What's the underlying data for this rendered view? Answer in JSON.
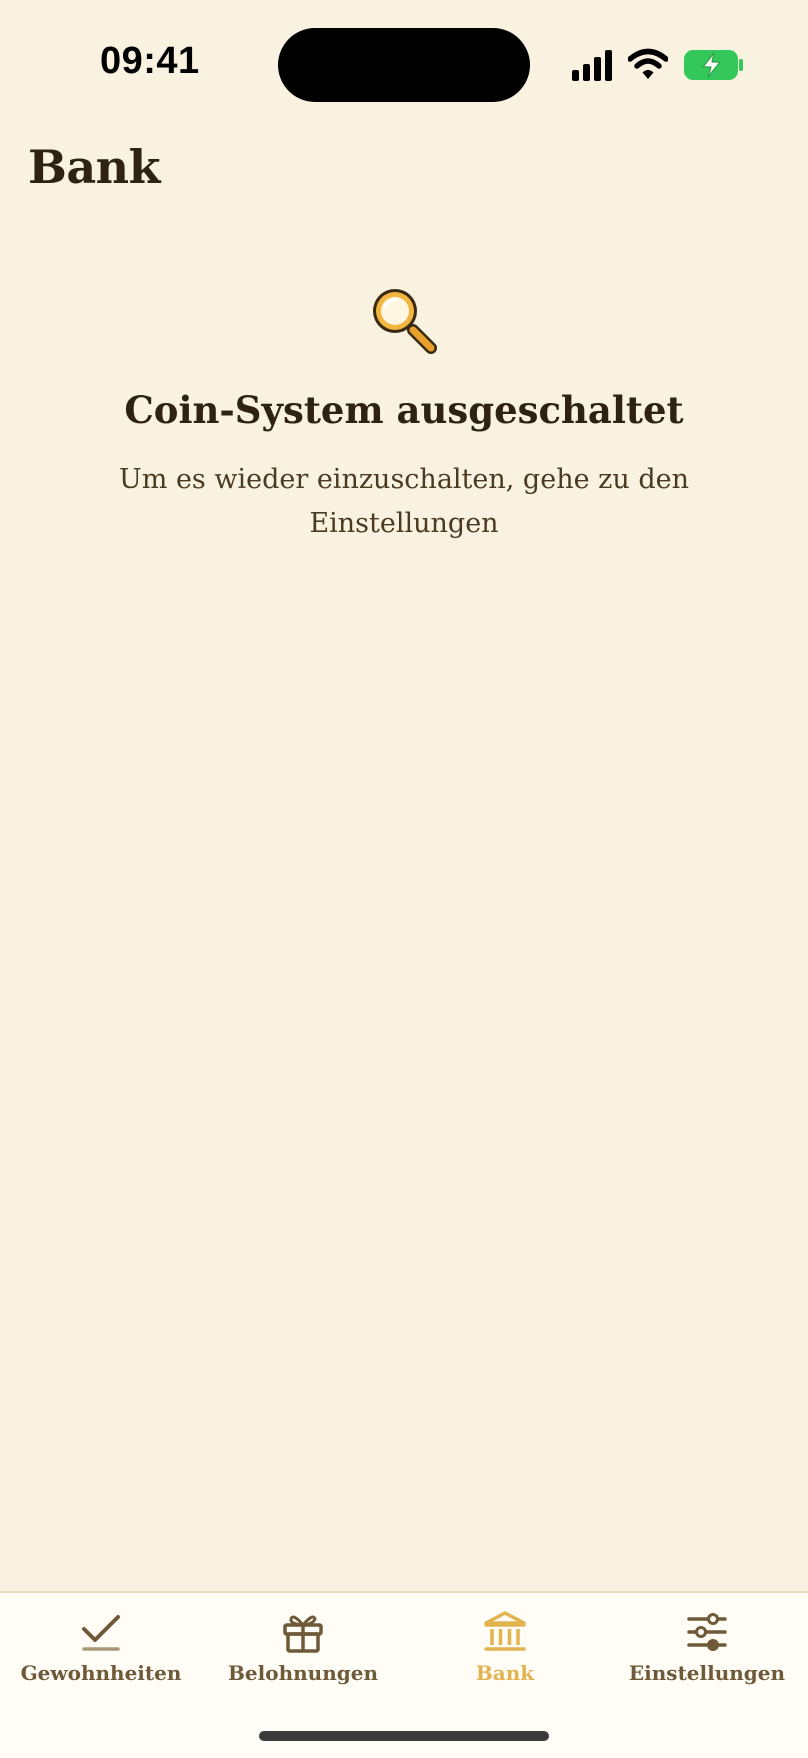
{
  "status_bar": {
    "time": "09:41",
    "icons": [
      "signal-icon",
      "wifi-icon",
      "battery-charging-icon"
    ],
    "battery_color": "#34C759"
  },
  "header": {
    "title": "Bank"
  },
  "empty_state": {
    "icon": "magnifying-glass-icon",
    "title": "Coin-System ausgeschaltet",
    "message": "Um es wieder einzuschalten, gehe zu den Einstellungen"
  },
  "tab_bar": {
    "active_color": "#E2B450",
    "inactive_color": "#6E5A38",
    "items": [
      {
        "label": "Gewohnheiten",
        "icon": "checkmark-icon",
        "active": false
      },
      {
        "label": "Belohnungen",
        "icon": "gift-icon",
        "active": false
      },
      {
        "label": "Bank",
        "icon": "bank-icon",
        "active": true
      },
      {
        "label": "Einstellungen",
        "icon": "sliders-icon",
        "active": false
      }
    ]
  }
}
